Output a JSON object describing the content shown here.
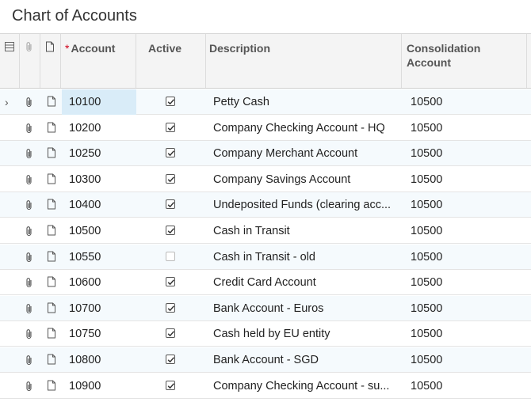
{
  "page": {
    "title": "Chart of Accounts"
  },
  "columns": {
    "account": "Account",
    "account_required": "*",
    "active": "Active",
    "description": "Description",
    "consolidation": "Consolidation Account"
  },
  "rows": [
    {
      "account": "10100",
      "active": true,
      "description": "Petty Cash",
      "consolidation": "10500"
    },
    {
      "account": "10200",
      "active": true,
      "description": "Company Checking Account - HQ",
      "consolidation": "10500"
    },
    {
      "account": "10250",
      "active": true,
      "description": "Company Merchant Account",
      "consolidation": "10500"
    },
    {
      "account": "10300",
      "active": true,
      "description": "Company Savings Account",
      "consolidation": "10500"
    },
    {
      "account": "10400",
      "active": true,
      "description": "Undeposited Funds (clearing acc...",
      "consolidation": "10500"
    },
    {
      "account": "10500",
      "active": true,
      "description": "Cash in Transit",
      "consolidation": "10500"
    },
    {
      "account": "10550",
      "active": false,
      "description": "Cash in Transit - old",
      "consolidation": "10500"
    },
    {
      "account": "10600",
      "active": true,
      "description": "Credit Card Account",
      "consolidation": "10500"
    },
    {
      "account": "10700",
      "active": true,
      "description": "Bank Account - Euros",
      "consolidation": "10500"
    },
    {
      "account": "10750",
      "active": true,
      "description": "Cash held by EU entity",
      "consolidation": "10500"
    },
    {
      "account": "10800",
      "active": true,
      "description": "Bank Account - SGD",
      "consolidation": "10500"
    },
    {
      "account": "10900",
      "active": true,
      "description": "Company Checking Account - su...",
      "consolidation": "10500"
    }
  ]
}
